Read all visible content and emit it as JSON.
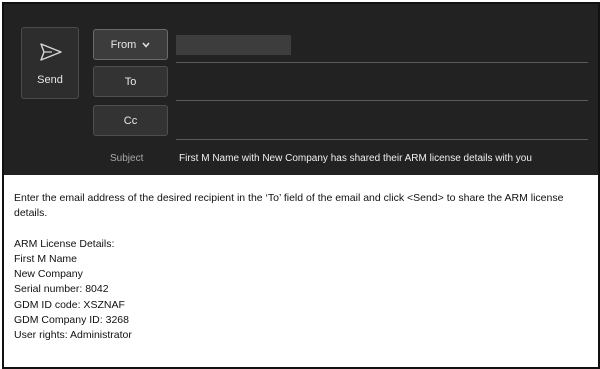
{
  "compose": {
    "send_label": "Send",
    "from_label": "From",
    "to_label": "To",
    "cc_label": "Cc",
    "subject_label": "Subject",
    "subject_value": "First M Name with New Company has shared their ARM license details with you"
  },
  "body": {
    "intro": "Enter the email address of the desired recipient in the ‘To’ field of the email and click <Send> to share the ARM license details.",
    "details_heading": "ARM License Details:",
    "lines": [
      "First M Name",
      "New Company",
      "Serial number: 8042",
      "GDM ID code: XSZNAF",
      "GDM Company ID: 3268",
      "User rights: Administrator"
    ]
  },
  "icons": {
    "send": "send-icon",
    "from_dropdown": "chevron-down-icon"
  },
  "colors": {
    "header_background": "#222222",
    "button_background": "#333333"
  }
}
